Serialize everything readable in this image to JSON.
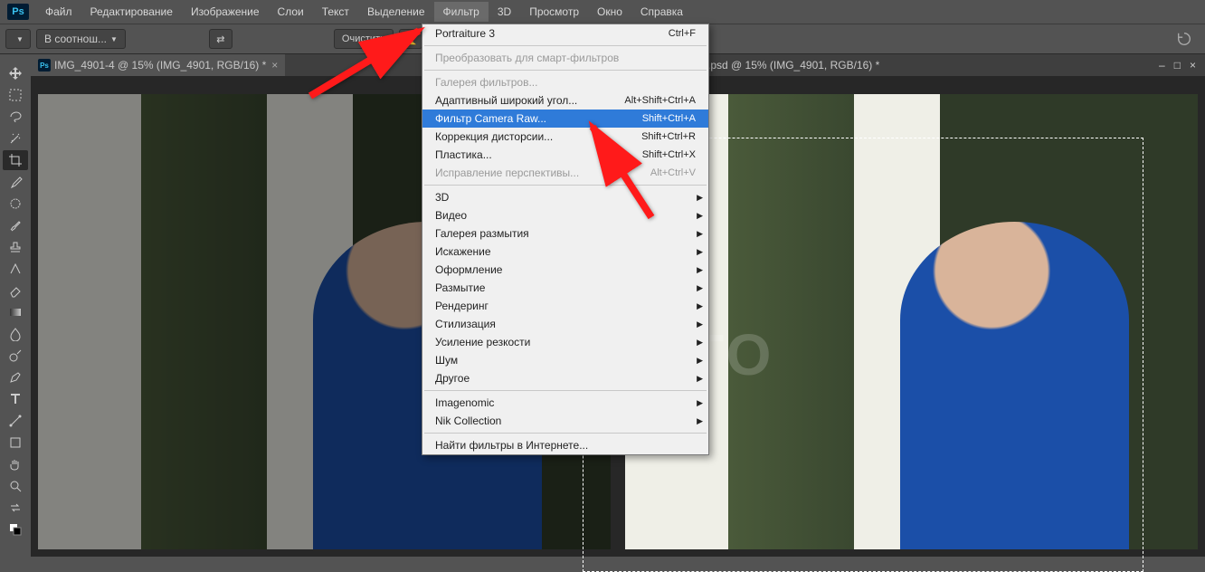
{
  "app_logo": "Ps",
  "menubar": [
    "Файл",
    "Редактирование",
    "Изображение",
    "Слои",
    "Текст",
    "Выделение",
    "Фильтр",
    "3D",
    "Просмотр",
    "Окно",
    "Справка"
  ],
  "active_menu_index": 6,
  "options_bar": {
    "ratio_dropdown": "В соотнош...",
    "clear_button": "Очистить"
  },
  "tabs": {
    "active": {
      "label": "IMG_4901-4 @ 15% (IMG_4901, RGB/16) *"
    },
    "behind": {
      "label": ".psd @ 15% (IMG_4901, RGB/16) *"
    }
  },
  "tools": [
    "move",
    "marquee",
    "lasso",
    "wand",
    "crop",
    "eyedrop",
    "patch",
    "brush",
    "stamp",
    "history",
    "eraser",
    "gradient",
    "blur",
    "dodge",
    "pen",
    "text",
    "path",
    "shape",
    "hand",
    "zoom",
    "swap",
    "colors"
  ],
  "active_tool_index": 4,
  "dropdown": {
    "groups": [
      [
        {
          "label": "Portraiture 3",
          "shortcut": "Ctrl+F"
        }
      ],
      [
        {
          "label": "Преобразовать для смарт-фильтров",
          "disabled": true
        }
      ],
      [
        {
          "label": "Галерея фильтров...",
          "disabled": true
        },
        {
          "label": "Адаптивный широкий угол...",
          "shortcut": "Alt+Shift+Ctrl+A"
        },
        {
          "label": "Фильтр Camera Raw...",
          "shortcut": "Shift+Ctrl+A",
          "highlight": true
        },
        {
          "label": "Коррекция дисторсии...",
          "shortcut": "Shift+Ctrl+R"
        },
        {
          "label": "Пластика...",
          "shortcut": "Shift+Ctrl+X"
        },
        {
          "label": "Исправление перспективы...",
          "shortcut": "Alt+Ctrl+V",
          "disabled": true
        }
      ],
      [
        {
          "label": "3D",
          "sub": true
        },
        {
          "label": "Видео",
          "sub": true
        },
        {
          "label": "Галерея размытия",
          "sub": true
        },
        {
          "label": "Искажение",
          "sub": true
        },
        {
          "label": "Оформление",
          "sub": true
        },
        {
          "label": "Размытие",
          "sub": true
        },
        {
          "label": "Рендеринг",
          "sub": true
        },
        {
          "label": "Стилизация",
          "sub": true
        },
        {
          "label": "Усиление резкости",
          "sub": true
        },
        {
          "label": "Шум",
          "sub": true
        },
        {
          "label": "Другое",
          "sub": true
        }
      ],
      [
        {
          "label": "Imagenomic",
          "sub": true
        },
        {
          "label": "Nik Collection",
          "sub": true
        }
      ],
      [
        {
          "label": "Найти фильтры в Интернете..."
        }
      ]
    ]
  },
  "watermark": "KONEKTO",
  "icons": {
    "chevron_down": "▼",
    "chevron_right": "▶",
    "close": "×",
    "minimize": "–",
    "maximize": "□"
  }
}
